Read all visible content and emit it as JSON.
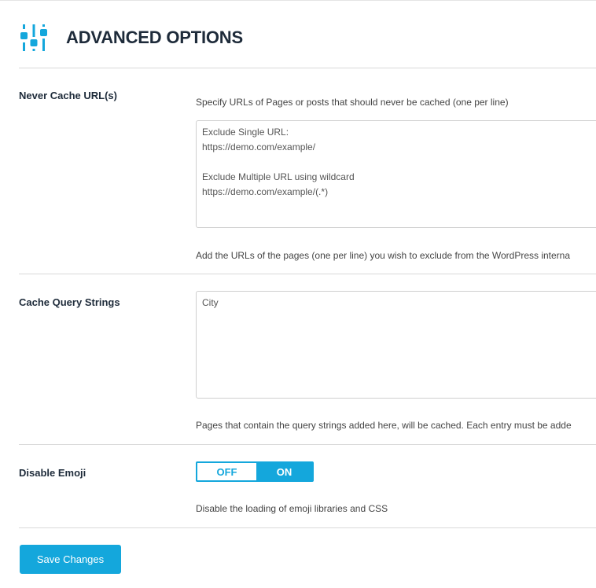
{
  "header": {
    "title": "ADVANCED OPTIONS",
    "icon": "sliders-icon"
  },
  "sections": {
    "never_cache": {
      "label": "Never Cache URL(s)",
      "description": "Specify URLs of Pages or posts that should never be cached (one per line)",
      "value": "Exclude Single URL:\nhttps://demo.com/example/\n\nExclude Multiple URL using wildcard\nhttps://demo.com/example/(.*)",
      "help": "Add the URLs of the pages (one per line) you wish to exclude from the WordPress interna"
    },
    "cache_query": {
      "label": "Cache Query Strings",
      "value": "City",
      "help": "Pages that contain the query strings added here, will be cached. Each entry must be adde"
    },
    "disable_emoji": {
      "label": "Disable Emoji",
      "toggle_off": "OFF",
      "toggle_on": "ON",
      "state": "ON",
      "help": "Disable the loading of emoji libraries and CSS"
    }
  },
  "actions": {
    "save_label": "Save Changes"
  },
  "colors": {
    "accent": "#14a7dc",
    "heading": "#1e2b3a"
  }
}
